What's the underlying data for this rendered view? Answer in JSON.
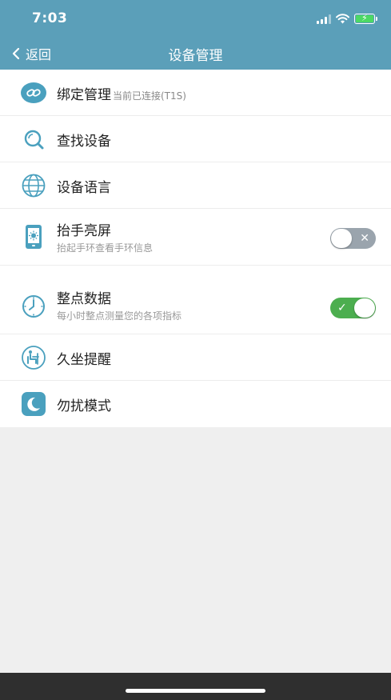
{
  "status_bar": {
    "time": "7:03"
  },
  "nav": {
    "back_label": "返回",
    "title": "设备管理"
  },
  "list": {
    "items": [
      {
        "label": "绑定管理",
        "sub": "当前已连接(T1S)",
        "icon": "link-icon"
      },
      {
        "label": "查找设备",
        "icon": "search-icon"
      },
      {
        "label": "设备语言",
        "icon": "globe-icon"
      },
      {
        "label": "抬手亮屏",
        "sub": "抬起手环查看手环信息",
        "icon": "raise-wrist-icon",
        "toggle": "off"
      },
      {
        "label": "整点数据",
        "sub": "每小时整点测量您的各项指标",
        "icon": "clock-icon",
        "toggle": "on"
      },
      {
        "label": "久坐提醒",
        "icon": "sedentary-icon"
      },
      {
        "label": "勿扰模式",
        "icon": "moon-icon"
      }
    ]
  },
  "colors": {
    "header": "#5b9fb9",
    "accent": "#4aa0be",
    "toggle_on": "#4cae4f",
    "toggle_off": "#9aa4ad"
  }
}
